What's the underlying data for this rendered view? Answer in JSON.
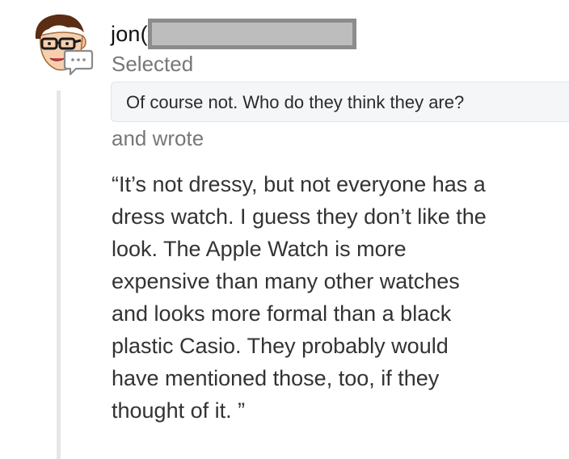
{
  "comment": {
    "author_visible": "jon(",
    "action_selected": "Selected",
    "selected_quote": "Of course not. Who do they think they are?",
    "action_wrote": "and wrote",
    "body": "“It’s not dressy, but not everyone has a\ndress watch. I guess they don’t like the\nlook. The Apple Watch is more\nexpensive than many other watches\nand looks more formal than a black\nplastic Casio. They probably would\nhave mentioned those, too, if they\nthought of it. ”"
  },
  "icons": {
    "avatar": "cartoon-avatar",
    "badge": "comment-bubble-icon"
  },
  "colors": {
    "action_text": "#777777",
    "quote_bg": "#f5f6f7",
    "redaction_fill": "#bdbdbd",
    "redaction_border": "#8c8c8c",
    "thread_line": "#e6e6e6"
  }
}
